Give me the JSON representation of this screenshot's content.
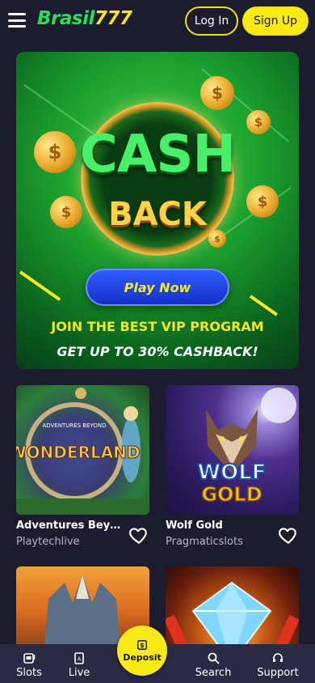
{
  "header": {
    "logo_part1": "Brasil",
    "logo_part2": "777",
    "login_label": "Log In",
    "signup_label": "Sign Up"
  },
  "banner": {
    "word1": "CASH",
    "word2": "BACK",
    "coin_symbol": "$",
    "play_label": "Play Now",
    "line1": "JOIN THE BEST VIP PROGRAM",
    "line2": "GET UP TO 30% CASHBACK!",
    "colors": {
      "primary": "#1a9b2c",
      "accent": "#f4e629",
      "button": "#2f5dff"
    }
  },
  "games": [
    {
      "title": "Adventures Beyond Wonderland",
      "provider": "Playtechlive",
      "art_text": "WONDERLAND",
      "art_subtext": "ADVENTURES BEYOND"
    },
    {
      "title": "Wolf Gold",
      "provider": "Pragmaticslots",
      "art_text": "WOLF",
      "art_subtext": "GOLD"
    },
    {
      "title": "",
      "provider": "",
      "art_text": ""
    },
    {
      "title": "",
      "provider": "",
      "art_text": ""
    }
  ],
  "bottom_nav": {
    "items": [
      {
        "label": "Slots",
        "icon": "slot-machine-icon"
      },
      {
        "label": "Live",
        "icon": "cards-icon"
      },
      {
        "label": "Search",
        "icon": "search-icon"
      },
      {
        "label": "Support",
        "icon": "headset-icon"
      }
    ],
    "deposit_label": "Deposit",
    "deposit_icon": "deposit-icon"
  },
  "theme": {
    "background": "#1d1b2e",
    "accent_yellow": "#f8ea16",
    "logo_green": "#26e05f",
    "nav_background": "#2b2a44"
  }
}
